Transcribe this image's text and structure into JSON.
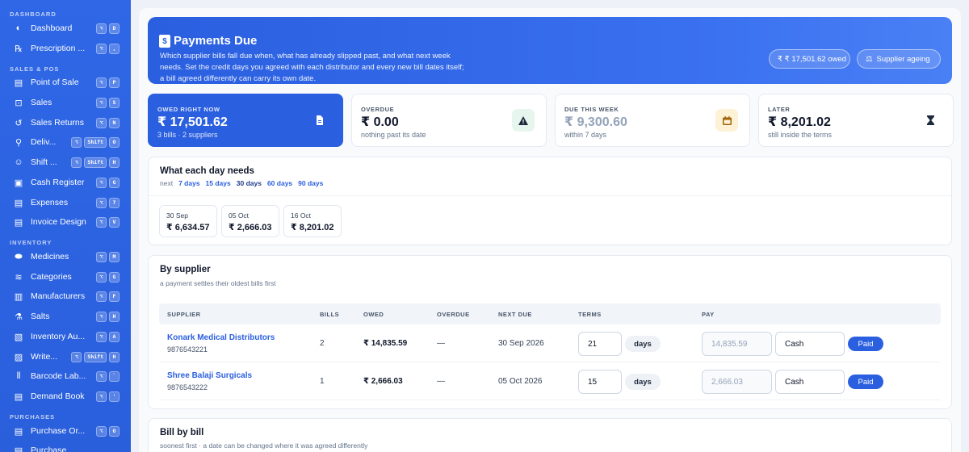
{
  "sidebar": {
    "sections": {
      "dashboard": "DASHBOARD",
      "sales": "SALES & POS",
      "inventory": "INVENTORY",
      "purchases": "PURCHASES"
    },
    "items": [
      {
        "label": "Dashboard",
        "icon": "palette-icon",
        "keys": [
          "⌥",
          "D"
        ]
      },
      {
        "label": "Prescription ...",
        "icon": "rx-icon",
        "keys": [
          "⌥",
          ","
        ]
      },
      {
        "label": "Point of Sale",
        "icon": "document-icon",
        "keys": [
          "⌥",
          "P"
        ]
      },
      {
        "label": "Sales",
        "icon": "cart-icon",
        "keys": [
          "⌥",
          "S"
        ]
      },
      {
        "label": "Sales Returns",
        "icon": "return-icon",
        "keys": [
          "⌥",
          "N"
        ]
      },
      {
        "label": "Deliv...",
        "icon": "bike-icon",
        "keys": [
          "⌥",
          "Shift",
          "O"
        ]
      },
      {
        "label": "Shift ...",
        "icon": "user-clock-icon",
        "keys": [
          "⌥",
          "Shift",
          "H"
        ]
      },
      {
        "label": "Cash Register",
        "icon": "register-icon",
        "keys": [
          "⌥",
          "G"
        ]
      },
      {
        "label": "Expenses",
        "icon": "receipt-icon",
        "keys": [
          "⌥",
          "7"
        ]
      },
      {
        "label": "Invoice Design",
        "icon": "invoice-icon",
        "keys": [
          "⌥",
          "V"
        ]
      },
      {
        "label": "Medicines",
        "icon": "pills-icon",
        "keys": [
          "⌥",
          "M"
        ]
      },
      {
        "label": "Categories",
        "icon": "layers-icon",
        "keys": [
          "⌥",
          "G"
        ]
      },
      {
        "label": "Manufacturers",
        "icon": "factory-icon",
        "keys": [
          "⌥",
          "F"
        ]
      },
      {
        "label": "Salts",
        "icon": "flask-icon",
        "keys": [
          "⌥",
          "H"
        ]
      },
      {
        "label": "Inventory Au...",
        "icon": "clipboard-icon",
        "keys": [
          "⌥",
          "A"
        ]
      },
      {
        "label": "Write...",
        "icon": "trash-icon",
        "keys": [
          "⌥",
          "Shift",
          "H"
        ]
      },
      {
        "label": "Barcode Lab...",
        "icon": "barcode-icon",
        "keys": [
          "⌥",
          "`"
        ]
      },
      {
        "label": "Demand Book",
        "icon": "book-icon",
        "keys": [
          "⌥",
          "'"
        ]
      },
      {
        "label": "Purchase Or...",
        "icon": "document-icon",
        "keys": [
          "⌥",
          "O"
        ]
      },
      {
        "label": "Purchase",
        "icon": "document-icon",
        "keys": []
      }
    ]
  },
  "header": {
    "title": "Payments Due",
    "description": "Which supplier bills fall due when, what has already slipped past, and what next week needs. Set the credit days you agreed with each distributor and every new bill dates itself; a bill agreed differently can carry its own date.",
    "owed_pill": "₹ ₹ 17,501.62 owed",
    "ageing_button": "Supplier ageing"
  },
  "stats": [
    {
      "label": "OWED RIGHT NOW",
      "value": "₹ 17,501.62",
      "sub": "3 bills · 2 suppliers",
      "icon": "document-icon",
      "accent": "#2a5fe0"
    },
    {
      "label": "OVERDUE",
      "value": "₹ 0.00",
      "sub": "nothing past its date",
      "icon": "warning-icon",
      "accent": "#e6f6ee"
    },
    {
      "label": "DUE THIS WEEK",
      "value": "₹ 9,300.60",
      "sub": "within 7 days",
      "icon": "calendar-icon",
      "accent": "#fdf1d6"
    },
    {
      "label": "LATER",
      "value": "₹ 8,201.02",
      "sub": "still inside the terms",
      "icon": "hourglass-icon",
      "accent": "#ffffff"
    }
  ],
  "daily": {
    "title": "What each day needs",
    "next_label": "next",
    "ranges": [
      "7 days",
      "15 days",
      "30 days",
      "60 days",
      "90 days"
    ],
    "selected_range": "30 days",
    "days": [
      {
        "date": "30 Sep",
        "amount": "₹ 6,634.57"
      },
      {
        "date": "05 Oct",
        "amount": "₹ 2,666.03"
      },
      {
        "date": "16 Oct",
        "amount": "₹ 8,201.02"
      }
    ]
  },
  "suppliers": {
    "title": "By supplier",
    "subtitle": "a payment settles their oldest bills first",
    "columns": [
      "SUPPLIER",
      "BILLS",
      "OWED",
      "OVERDUE",
      "NEXT DUE",
      "TERMS",
      "PAY"
    ],
    "rows": [
      {
        "name": "Konark Medical Distributors",
        "phone": "9876543221",
        "bills": "2",
        "owed": "₹ 14,835.59",
        "overdue": "—",
        "next_due": "30 Sep 2026",
        "terms": "21",
        "days_label": "days",
        "pay_amount": "14,835.59",
        "method": "Cash",
        "action": "Paid"
      },
      {
        "name": "Shree Balaji Surgicals",
        "phone": "9876543222",
        "bills": "1",
        "owed": "₹ 2,666.03",
        "overdue": "—",
        "next_due": "05 Oct 2026",
        "terms": "15",
        "days_label": "days",
        "pay_amount": "2,666.03",
        "method": "Cash",
        "action": "Paid"
      }
    ]
  },
  "bills": {
    "title": "Bill by bill",
    "subtitle": "soonest first · a date can be changed where it was agreed differently"
  }
}
